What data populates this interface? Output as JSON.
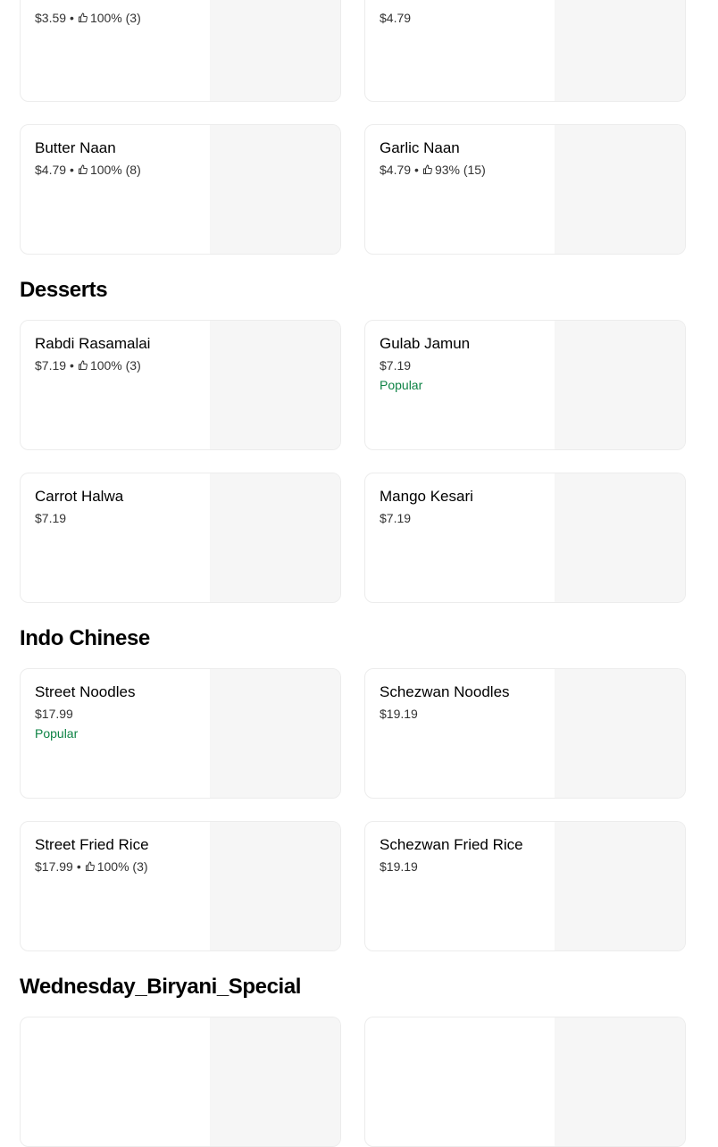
{
  "top_row": [
    {
      "price": "$3.59",
      "rating": "100% (3)"
    },
    {
      "price": "$4.79"
    }
  ],
  "naan_row": [
    {
      "name": "Butter Naan",
      "price": "$4.79",
      "rating": "100% (8)"
    },
    {
      "name": "Garlic Naan",
      "price": "$4.79",
      "rating": "93% (15)"
    }
  ],
  "desserts": {
    "title": "Desserts",
    "items": [
      {
        "name": "Rabdi Rasamalai",
        "price": "$7.19",
        "rating": "100% (3)"
      },
      {
        "name": "Gulab Jamun",
        "price": "$7.19",
        "badge": "Popular"
      },
      {
        "name": "Carrot Halwa",
        "price": "$7.19"
      },
      {
        "name": "Mango Kesari",
        "price": "$7.19"
      }
    ]
  },
  "indo_chinese": {
    "title": "Indo Chinese",
    "items": [
      {
        "name": "Street Noodles",
        "price": "$17.99",
        "badge": "Popular"
      },
      {
        "name": "Schezwan Noodles",
        "price": "$19.19"
      },
      {
        "name": "Street Fried Rice",
        "price": "$17.99",
        "rating": "100% (3)"
      },
      {
        "name": "Schezwan Fried Rice",
        "price": "$19.19"
      }
    ]
  },
  "biryani_special": {
    "title": "Wednesday_Biryani_Special"
  },
  "icons": {
    "rating": "thumbs-up-icon"
  },
  "colors": {
    "popular": "#0e8345",
    "image_placeholder": "#f6f6f6",
    "border": "#ececec"
  }
}
